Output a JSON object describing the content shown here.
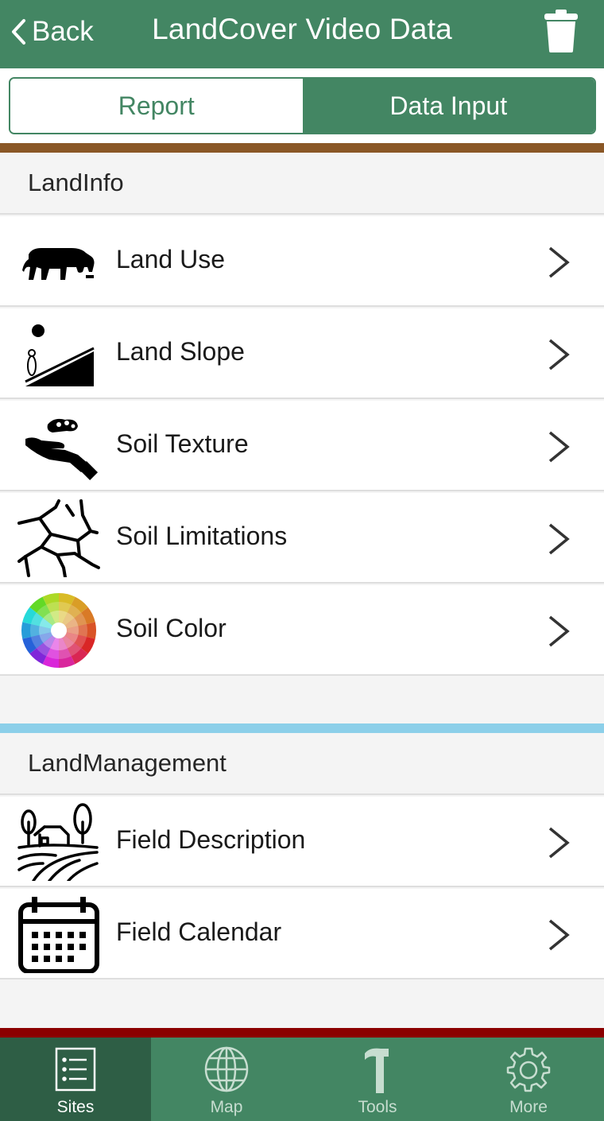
{
  "header": {
    "back_label": "Back",
    "title": "LandCover Video Data",
    "back_icon": "chevron-left-icon",
    "delete_icon": "trash-icon"
  },
  "segmented": {
    "options": [
      {
        "label": "Report",
        "selected": false
      },
      {
        "label": "Data Input",
        "selected": true
      }
    ]
  },
  "sections": [
    {
      "title": "LandInfo",
      "band_color": "#8a5726",
      "items": [
        {
          "label": "Land Use",
          "icon": "grazing-cow-icon"
        },
        {
          "label": "Land Slope",
          "icon": "slope-icon"
        },
        {
          "label": "Soil Texture",
          "icon": "hand-soil-icon"
        },
        {
          "label": "Soil Limitations",
          "icon": "cracked-soil-icon"
        },
        {
          "label": "Soil Color",
          "icon": "color-wheel-icon"
        }
      ]
    },
    {
      "title": "LandManagement",
      "band_color": "#8ccfe9",
      "items": [
        {
          "label": "Field Description",
          "icon": "farm-field-icon"
        },
        {
          "label": "Field Calendar",
          "icon": "calendar-icon"
        }
      ]
    }
  ],
  "footer_band_color": "#8b0000",
  "tabbar": {
    "tabs": [
      {
        "label": "Sites",
        "icon": "list-icon",
        "active": true
      },
      {
        "label": "Map",
        "icon": "globe-icon",
        "active": false
      },
      {
        "label": "Tools",
        "icon": "hammer-icon",
        "active": false
      },
      {
        "label": "More",
        "icon": "gear-icon",
        "active": false
      }
    ]
  },
  "colors": {
    "primary": "#438663",
    "primary_dark": "#2e5e45",
    "background": "#f4f4f4"
  }
}
